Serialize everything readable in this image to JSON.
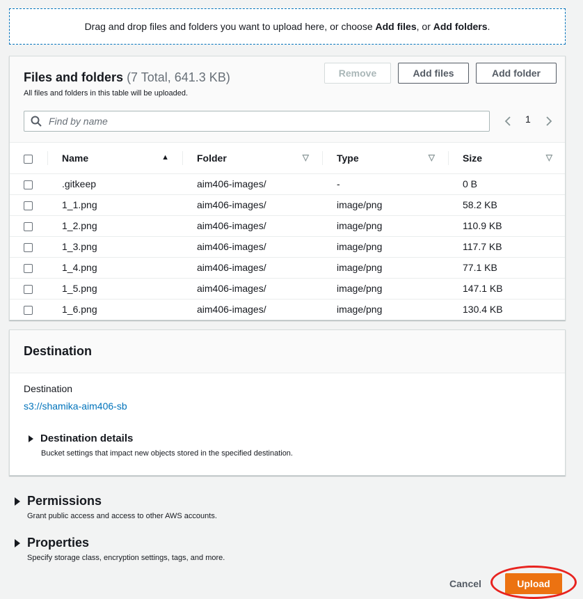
{
  "dropzone": {
    "text_before": "Drag and drop files and folders you want to upload here, or choose ",
    "add_files": "Add files",
    "text_mid": ", or ",
    "add_folders": "Add folders",
    "text_end": "."
  },
  "files": {
    "title": "Files and folders",
    "count": "(7 Total, 641.3 KB)",
    "subtitle": "All files and folders in this table will be uploaded.",
    "remove_label": "Remove",
    "add_files_label": "Add files",
    "add_folder_label": "Add folder",
    "search_placeholder": "Find by name",
    "page": "1",
    "columns": {
      "name": "Name",
      "folder": "Folder",
      "type": "Type",
      "size": "Size"
    },
    "rows": [
      {
        "name": ".gitkeep",
        "folder": "aim406-images/",
        "type": "-",
        "size": "0 B"
      },
      {
        "name": "1_1.png",
        "folder": "aim406-images/",
        "type": "image/png",
        "size": "58.2 KB"
      },
      {
        "name": "1_2.png",
        "folder": "aim406-images/",
        "type": "image/png",
        "size": "110.9 KB"
      },
      {
        "name": "1_3.png",
        "folder": "aim406-images/",
        "type": "image/png",
        "size": "117.7 KB"
      },
      {
        "name": "1_4.png",
        "folder": "aim406-images/",
        "type": "image/png",
        "size": "77.1 KB"
      },
      {
        "name": "1_5.png",
        "folder": "aim406-images/",
        "type": "image/png",
        "size": "147.1 KB"
      },
      {
        "name": "1_6.png",
        "folder": "aim406-images/",
        "type": "image/png",
        "size": "130.4 KB"
      }
    ]
  },
  "destination": {
    "header": "Destination",
    "label": "Destination",
    "link": "s3://shamika-aim406-sb",
    "details_title": "Destination details",
    "details_desc": "Bucket settings that impact new objects stored in the specified destination."
  },
  "permissions": {
    "title": "Permissions",
    "desc": "Grant public access and access to other AWS accounts."
  },
  "properties": {
    "title": "Properties",
    "desc": "Specify storage class, encryption settings, tags, and more."
  },
  "actions": {
    "cancel": "Cancel",
    "upload": "Upload"
  },
  "colors": {
    "accent": "#ec7211",
    "link": "#0073bb",
    "highlight": "#e8231f"
  }
}
